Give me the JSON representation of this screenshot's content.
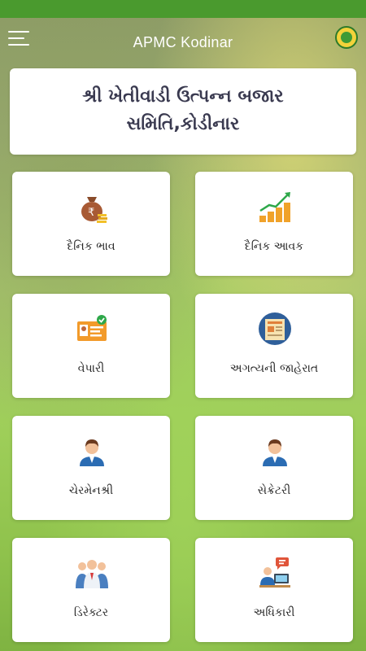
{
  "app_bar": {
    "title": "APMC Kodinar",
    "menu_icon": "hamburger-menu-icon",
    "logo": "apmc-logo"
  },
  "header": {
    "org_name_line1": "શ્રી ખેતીવાડી ઉત્પન્ન બજાર",
    "org_name_line2": "સમિતિ,કોડીનાર"
  },
  "tiles": [
    {
      "label": "દૈનિક ભાવ",
      "icon": "money-bag-icon"
    },
    {
      "label": "દૈનિક આવક",
      "icon": "coins-growth-chart-icon"
    },
    {
      "label": "વેપારી",
      "icon": "trader-id-card-icon"
    },
    {
      "label": "અગત્યની જાહેરાત",
      "icon": "newspaper-icon"
    },
    {
      "label": "ચેરમેનશ્રી",
      "icon": "chairman-person-icon"
    },
    {
      "label": "સેક્રેટરી",
      "icon": "secretary-person-icon"
    },
    {
      "label": "ડિરેક્ટર",
      "icon": "directors-group-icon"
    },
    {
      "label": "અધિકારી",
      "icon": "officer-at-desk-icon"
    }
  ],
  "colors": {
    "status_bar": "#4a9a2e",
    "card": "#ffffff",
    "heading_text": "#3a3a50"
  }
}
